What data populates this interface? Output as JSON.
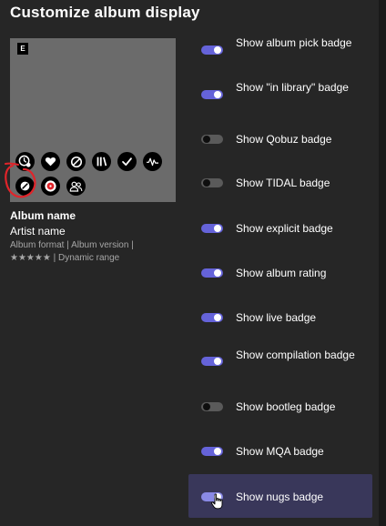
{
  "dialog": {
    "title": "Customize album display"
  },
  "preview": {
    "explicit_tag": "E",
    "album_name": "Album name",
    "artist_name": "Artist name",
    "meta_line1": "Album format | Album version |",
    "meta_line2": "★★★★★ | Dynamic range",
    "badges_row1": [
      "clock-user-icon",
      "heart-icon",
      "no-entry-icon",
      "library-icon",
      "check-icon",
      "waveform-icon"
    ],
    "badges_row2": [
      "nugs-icon",
      "record-icon",
      "people-icon"
    ],
    "annotation_color": "#e0242a"
  },
  "options": [
    {
      "label": "Show album pick badge",
      "on": true
    },
    {
      "label": "Show \"in library\" badge",
      "on": true
    },
    {
      "label": "Show Qobuz badge",
      "on": false
    },
    {
      "label": "Show TIDAL badge",
      "on": false
    },
    {
      "label": "Show explicit badge",
      "on": true
    },
    {
      "label": "Show album rating",
      "on": true
    },
    {
      "label": "Show live badge",
      "on": true
    },
    {
      "label": "Show compilation badge",
      "on": true
    },
    {
      "label": "Show bootleg badge",
      "on": false
    },
    {
      "label": "Show MQA badge",
      "on": true
    },
    {
      "label": "Show nugs badge",
      "on": true
    }
  ],
  "colors": {
    "toggle_on": "#6563d9",
    "toggle_off": "#5a5a5a",
    "hover_row": "#39375a",
    "background": "#262626"
  }
}
